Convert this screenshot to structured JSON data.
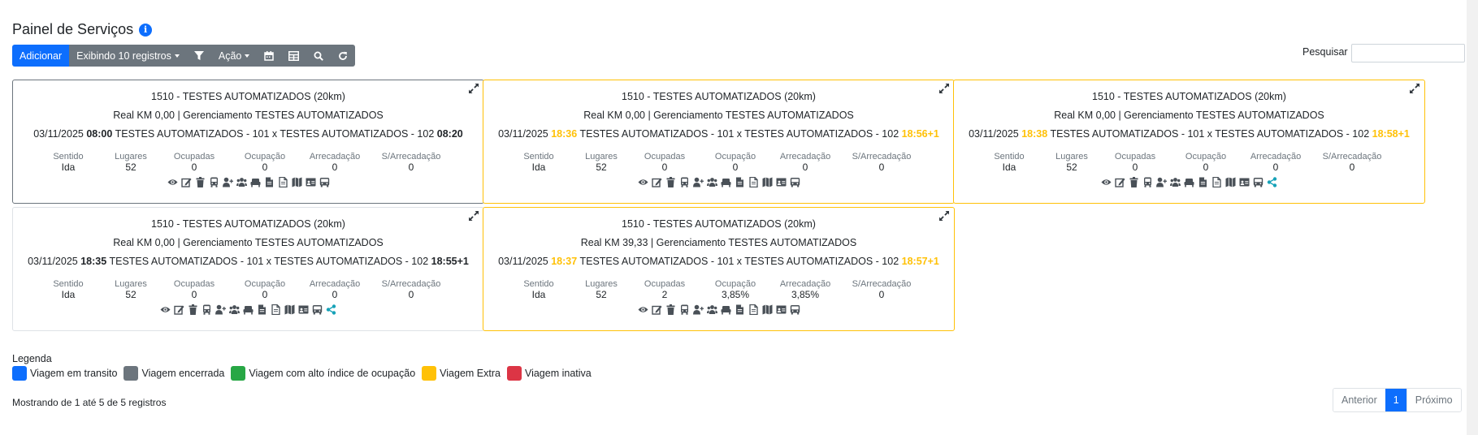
{
  "page": {
    "title": "Painel de Serviços"
  },
  "toolbar": {
    "add_label": "Adicionar",
    "show_label": "Exibindo 10 registros",
    "action_label": "Ação",
    "icons": [
      "filter-icon",
      "calendar-icon",
      "table-icon",
      "search-icon",
      "refresh-icon"
    ]
  },
  "search": {
    "label": "Pesquisar",
    "value": ""
  },
  "stat_headers": [
    "Sentido",
    "Lugares",
    "Ocupadas",
    "Ocupação",
    "Arrecadação",
    "S/Arrecadação"
  ],
  "cards": [
    {
      "status": "encerrada",
      "route": "1510 - TESTES AUTOMATIZADOS (20km)",
      "info": "Real KM 0,00 | Gerenciamento TESTES AUTOMATIZADOS",
      "date": "03/11/2025",
      "dep": "08:00",
      "trip": "TESTES AUTOMATIZADOS - 101 x TESTES AUTOMATIZADOS - 102",
      "arr": "08:20",
      "stats": [
        "Ida",
        "52",
        "0",
        "0",
        "0",
        "0"
      ],
      "share": false
    },
    {
      "status": "extra",
      "route": "1510 - TESTES AUTOMATIZADOS (20km)",
      "info": "Real KM 0,00 | Gerenciamento TESTES AUTOMATIZADOS",
      "date": "03/11/2025",
      "dep": "18:36",
      "trip": "TESTES AUTOMATIZADOS - 101 x TESTES AUTOMATIZADOS - 102",
      "arr": "18:56+1",
      "stats": [
        "Ida",
        "52",
        "0",
        "0",
        "0",
        "0"
      ],
      "share": false
    },
    {
      "status": "extra",
      "route": "1510 - TESTES AUTOMATIZADOS (20km)",
      "info": "Real KM 0,00 | Gerenciamento TESTES AUTOMATIZADOS",
      "date": "03/11/2025",
      "dep": "18:38",
      "trip": "TESTES AUTOMATIZADOS - 101 x TESTES AUTOMATIZADOS - 102",
      "arr": "18:58+1",
      "stats": [
        "Ida",
        "52",
        "0",
        "0",
        "0",
        "0"
      ],
      "share": true
    },
    {
      "status": "normal",
      "route": "1510 - TESTES AUTOMATIZADOS (20km)",
      "info": "Real KM 0,00 | Gerenciamento TESTES AUTOMATIZADOS",
      "date": "03/11/2025",
      "dep": "18:35",
      "trip": "TESTES AUTOMATIZADOS - 101 x TESTES AUTOMATIZADOS - 102",
      "arr": "18:55+1",
      "stats": [
        "Ida",
        "52",
        "0",
        "0",
        "0",
        "0"
      ],
      "share": true
    },
    {
      "status": "extra",
      "route": "1510 - TESTES AUTOMATIZADOS (20km)",
      "info": "Real KM 39,33 | Gerenciamento TESTES AUTOMATIZADOS",
      "date": "03/11/2025",
      "dep": "18:37",
      "trip": "TESTES AUTOMATIZADOS - 101 x TESTES AUTOMATIZADOS - 102",
      "arr": "18:57+1",
      "stats": [
        "Ida",
        "52",
        "2",
        "3,85%",
        "3,85%",
        "0"
      ],
      "share": false
    }
  ],
  "card_icons": [
    "eye-icon",
    "edit-icon",
    "trash-icon",
    "bus-front-icon",
    "user-plus-icon",
    "users-icon",
    "seat-icon",
    "file-icon",
    "document-icon",
    "map-icon",
    "id-card-icon",
    "bus-icon"
  ],
  "legend": {
    "title": "Legenda",
    "items": [
      {
        "label": "Viagem em transito",
        "color": "#0d6efd"
      },
      {
        "label": "Viagem encerrada",
        "color": "#6c757d"
      },
      {
        "label": "Viagem com alto índice de ocupação",
        "color": "#28a745"
      },
      {
        "label": "Viagem Extra",
        "color": "#ffc107"
      },
      {
        "label": "Viagem inativa",
        "color": "#dc3545"
      }
    ]
  },
  "footer": {
    "text": "Mostrando de 1 até 5 de 5 registros"
  },
  "pagination": {
    "prev": "Anterior",
    "current": "1",
    "next": "Próximo"
  },
  "colors": {
    "primary": "#0d6efd",
    "secondary": "#6c757d",
    "warning": "#ffc107",
    "icon": "#495057",
    "share": "#17a2b8"
  }
}
